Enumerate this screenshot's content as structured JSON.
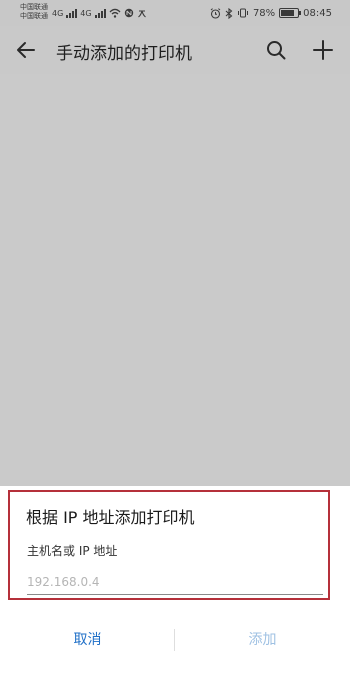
{
  "status_bar": {
    "carrier_1": "中国联通",
    "carrier_2": "中国联通",
    "network_1": "4G",
    "network_2": "4G",
    "battery_percent": "78%",
    "battery_level": 0.78,
    "time": "08:45",
    "icons": [
      "signal-icon",
      "wifi-icon",
      "nfc-icon",
      "notification-icon",
      "alarm-icon",
      "bluetooth-icon",
      "vibrate-icon",
      "battery-icon"
    ]
  },
  "app_bar": {
    "title": "手动添加的打印机",
    "icons": [
      "back-arrow-icon",
      "search-icon",
      "plus-icon"
    ]
  },
  "dialog": {
    "title": "根据 IP 地址添加打印机",
    "field_label": "主机名或 IP 地址",
    "input_placeholder": "192.168.0.4",
    "input_value": "",
    "cancel_label": "取消",
    "add_label": "添加",
    "highlight_color": "#b5303a"
  },
  "colors": {
    "background": "#cacaca",
    "accent": "#1f6fc7",
    "disabled_accent": "#9fc1e3"
  }
}
